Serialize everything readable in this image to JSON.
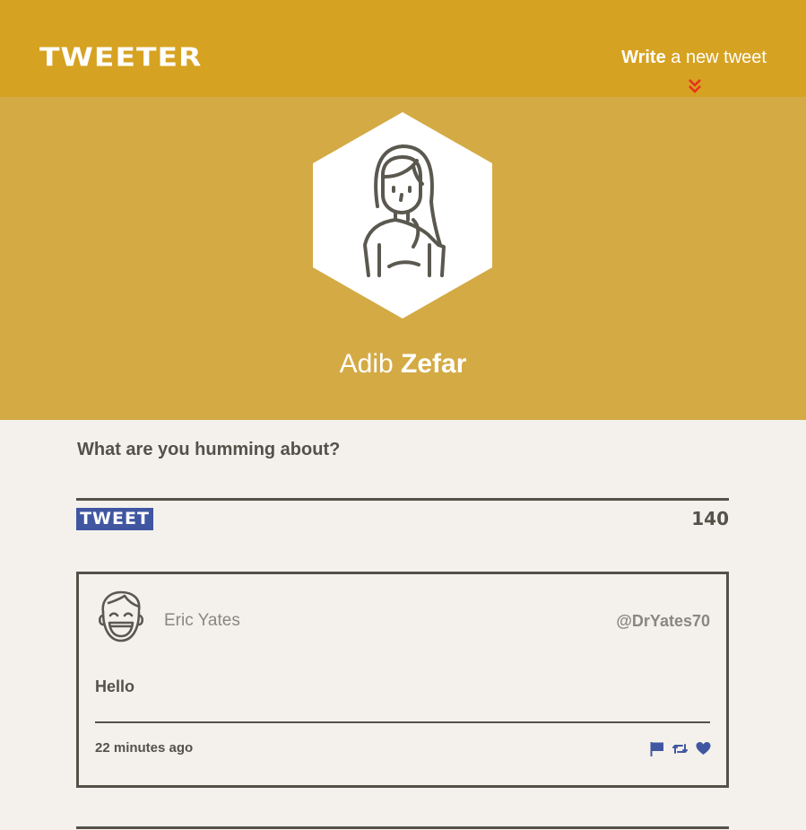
{
  "nav": {
    "brand": "TWEETER",
    "compose_bold": "Write",
    "compose_rest": " a new tweet",
    "chevron_icon": "double-chevron-down",
    "chevron_color": "#e8321c"
  },
  "profile": {
    "first_name": "Adib",
    "last_name": "Zefar",
    "avatar_icon": "woman-avatar"
  },
  "compose": {
    "prompt": "What are you humming about?",
    "tweet_button": "TWEET",
    "counter": "140"
  },
  "tweets": [
    {
      "author": "Eric Yates",
      "handle": "@DrYates70",
      "avatar_icon": "laughing-man-avatar",
      "text": "Hello",
      "timestamp": "22 minutes ago",
      "actions": [
        "flag-icon",
        "retweet-icon",
        "heart-icon"
      ]
    }
  ],
  "colors": {
    "nav_bg": "#d6a221",
    "profile_bg": "#d4aa44",
    "page_bg": "#f4f1ec",
    "text_dark": "#545149",
    "accent_blue": "#4056a1"
  }
}
